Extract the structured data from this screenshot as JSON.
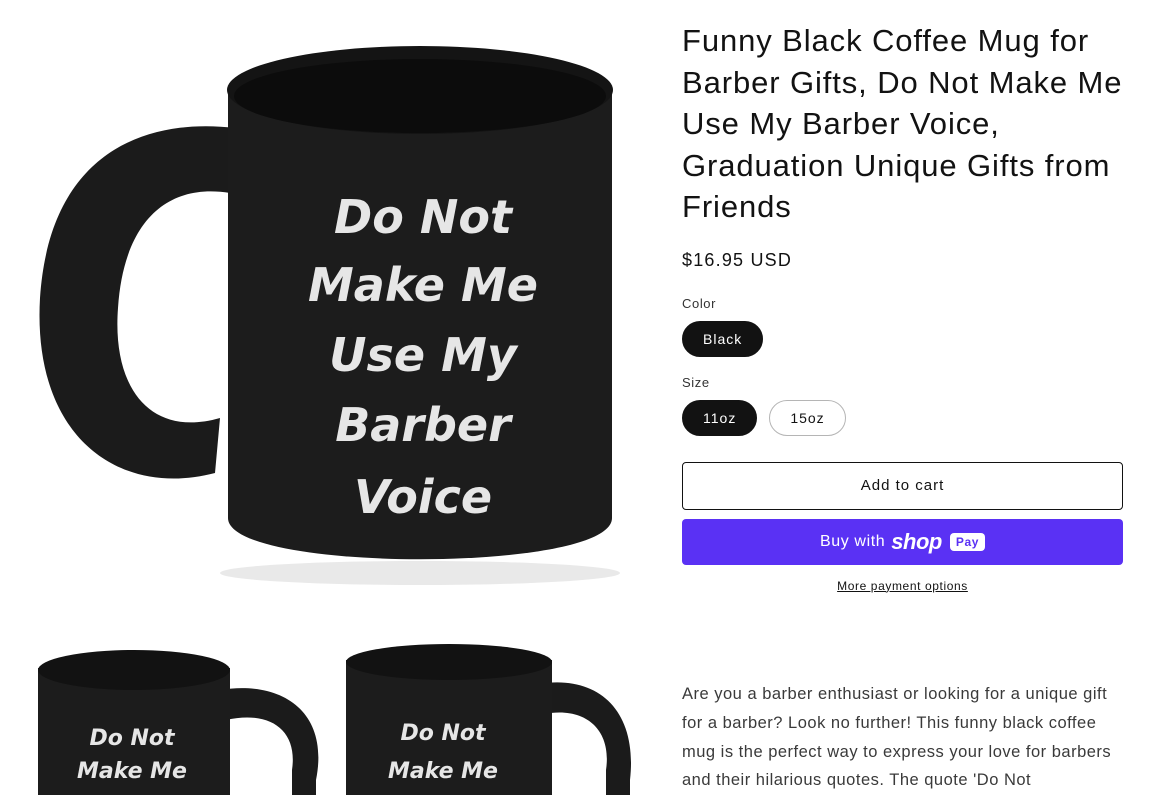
{
  "product": {
    "title": "Funny Black Coffee Mug for Barber Gifts, Do Not Make Me Use My Barber Voice, Graduation Unique Gifts from Friends",
    "price": "$16.95 USD"
  },
  "images": {
    "main_text_lines": [
      "Do Not",
      "Make Me",
      "Use My",
      "Barber",
      "Voice"
    ],
    "thumb_text_lines": [
      "Do Not",
      "Make Me"
    ]
  },
  "options": {
    "color_label": "Color",
    "color_values": [
      "Black"
    ],
    "size_label": "Size",
    "size_values": [
      "11oz",
      "15oz"
    ]
  },
  "actions": {
    "add_to_cart": "Add to cart",
    "buy_with": "Buy with",
    "shop_word": "shop",
    "pay_badge": "Pay",
    "more_payment": "More payment options"
  },
  "description": "Are you a barber enthusiast or looking for a unique gift for a barber? Look no further! This funny black coffee mug is the perfect way to express your love for barbers and their hilarious quotes. The quote 'Do Not",
  "colors": {
    "accent": "#5a31f4",
    "text": "#121212",
    "mug": "#1b1b1b"
  }
}
